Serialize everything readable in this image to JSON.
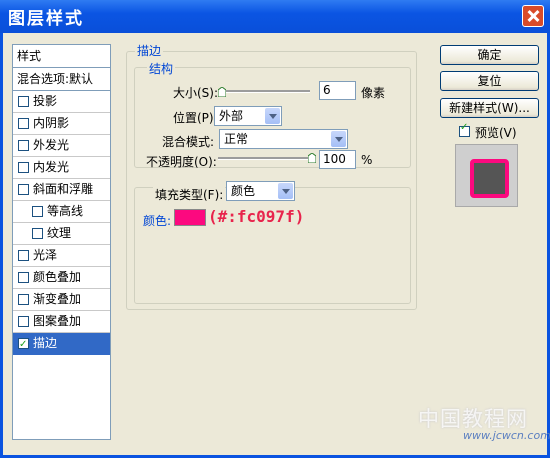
{
  "window": {
    "title": "图层样式"
  },
  "style_list": {
    "header": "样式",
    "blend_options": "混合选项:默认",
    "items": [
      {
        "label": "投影",
        "checked": false,
        "sub": false,
        "selected": false
      },
      {
        "label": "内阴影",
        "checked": false,
        "sub": false,
        "selected": false
      },
      {
        "label": "外发光",
        "checked": false,
        "sub": false,
        "selected": false
      },
      {
        "label": "内发光",
        "checked": false,
        "sub": false,
        "selected": false
      },
      {
        "label": "斜面和浮雕",
        "checked": false,
        "sub": false,
        "selected": false
      },
      {
        "label": "等高线",
        "checked": false,
        "sub": true,
        "selected": false
      },
      {
        "label": "纹理",
        "checked": false,
        "sub": true,
        "selected": false
      },
      {
        "label": "光泽",
        "checked": false,
        "sub": false,
        "selected": false
      },
      {
        "label": "颜色叠加",
        "checked": false,
        "sub": false,
        "selected": false
      },
      {
        "label": "渐变叠加",
        "checked": false,
        "sub": false,
        "selected": false
      },
      {
        "label": "图案叠加",
        "checked": false,
        "sub": false,
        "selected": false
      },
      {
        "label": "描边",
        "checked": true,
        "sub": false,
        "selected": true
      }
    ]
  },
  "stroke": {
    "group_title": "描边",
    "structure": {
      "title": "结构",
      "size_label": "大小(S):",
      "size_value": "6",
      "size_unit": "像素",
      "position_label": "位置(P):",
      "position_value": "外部",
      "blend_label": "混合模式:",
      "blend_value": "正常",
      "opacity_label": "不透明度(O):",
      "opacity_value": "100",
      "opacity_unit": "%"
    },
    "fill": {
      "type_label": "填充类型(F):",
      "type_value": "颜色",
      "color_label": "颜色:",
      "color_hex": "#fc097f",
      "color_note": "(#:fc097f)"
    }
  },
  "buttons": {
    "ok": "确定",
    "reset": "复位",
    "new_style": "新建样式(W)...",
    "preview_label": "预览(V)",
    "preview_checked": true
  },
  "watermark": {
    "text": "中国教程网",
    "url": "www.jcwcn.com"
  },
  "colors": {
    "title_bar": "#0b55e3",
    "accent_text": "#0046d5",
    "stroke_color": "#fc097f",
    "selection": "#3169c6"
  }
}
